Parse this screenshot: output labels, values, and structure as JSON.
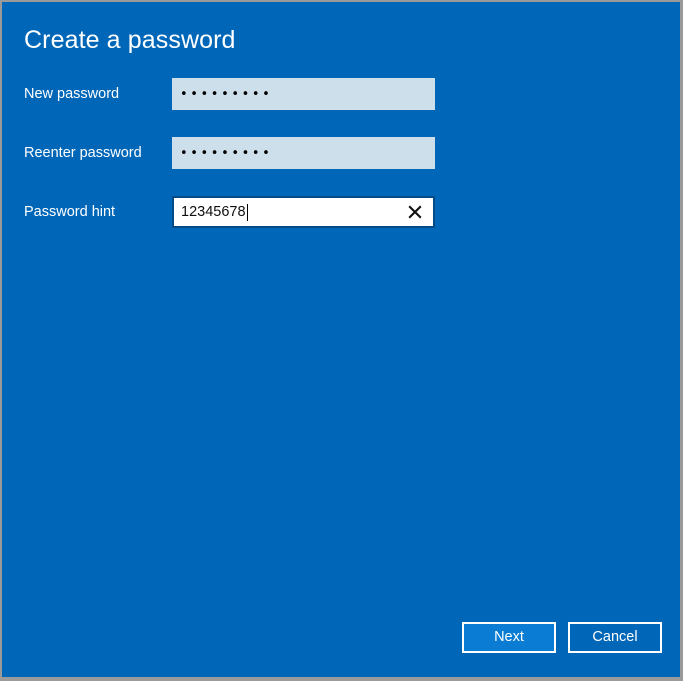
{
  "window": {
    "background_color": "#0067B8",
    "border_color": "#9a9a9a"
  },
  "header": {
    "title": "Create a password"
  },
  "form": {
    "fields": [
      {
        "label": "New password",
        "type": "password",
        "value": "•••••••••",
        "masked_char_count": 9,
        "background_color": "#CEDFEC",
        "focused": false
      },
      {
        "label": "Reenter password",
        "type": "password",
        "value": "•••••••••",
        "masked_char_count": 9,
        "background_color": "#CEDFEC",
        "focused": false
      },
      {
        "label": "Password hint",
        "type": "text",
        "value": "12345678",
        "placeholder": "",
        "background_color": "#FFFFFF",
        "border_color": "#004B87",
        "focused": true,
        "clear_icon": "close-icon"
      }
    ]
  },
  "footer": {
    "buttons": [
      {
        "label": "Next",
        "primary": true,
        "background_color": "#0A7CD4",
        "border_color": "#FFFFFF"
      },
      {
        "label": "Cancel",
        "primary": false,
        "background_color": "#0067B8",
        "border_color": "#FFFFFF"
      }
    ]
  }
}
